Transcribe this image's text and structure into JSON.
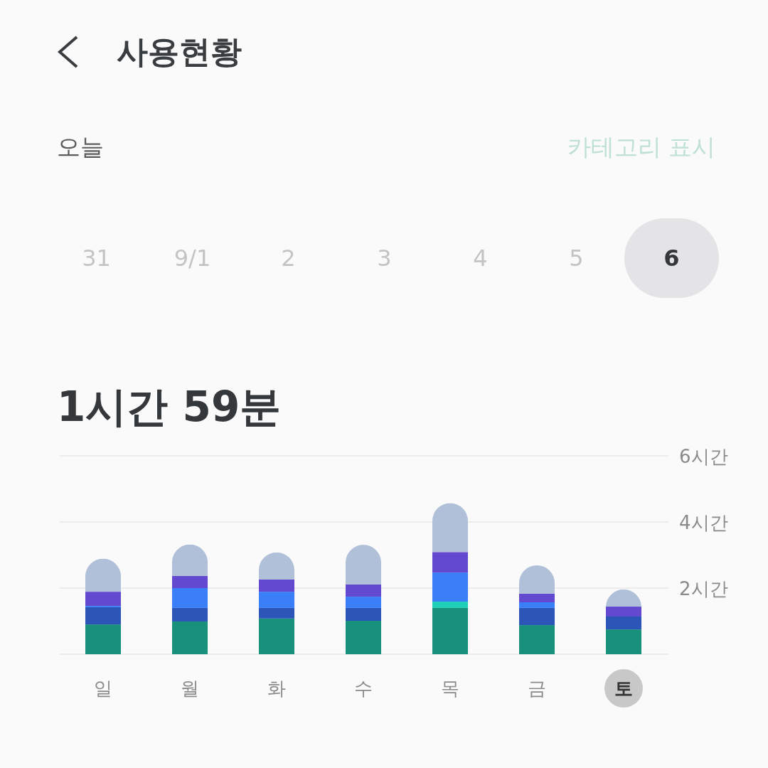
{
  "header": {
    "title": "사용현황"
  },
  "period": {
    "label": "오늘",
    "action": "카테고리 표시"
  },
  "dates": [
    {
      "label": "31",
      "selected": false
    },
    {
      "label": "9/1",
      "selected": false
    },
    {
      "label": "2",
      "selected": false
    },
    {
      "label": "3",
      "selected": false
    },
    {
      "label": "4",
      "selected": false
    },
    {
      "label": "5",
      "selected": false
    },
    {
      "label": "6",
      "selected": true
    }
  ],
  "total": "1시간 59분",
  "usage_chart": {
    "chart_data": {
      "type": "bar",
      "stacked": true,
      "ylim": [
        0,
        6
      ],
      "yticks": [
        {
          "value": 2,
          "label": "2시간"
        },
        {
          "value": 4,
          "label": "4시간"
        },
        {
          "value": 6,
          "label": "6시간"
        }
      ],
      "series": [
        {
          "color": "#17907c",
          "values": [
            0.9,
            0.99,
            1.08,
            1.01,
            1.4,
            0.88,
            0.75
          ]
        },
        {
          "color": "#2b56b8",
          "values": [
            0.52,
            0.41,
            0.32,
            0.39,
            0,
            0.52,
            0.39
          ]
        },
        {
          "color": "#1fd0b8",
          "values": [
            0,
            0,
            0,
            0,
            0.19,
            0,
            0
          ]
        },
        {
          "color": "#3a7ff8",
          "values": [
            0.04,
            0.6,
            0.49,
            0.34,
            0.88,
            0.17,
            0
          ]
        },
        {
          "color": "#6349cf",
          "values": [
            0.43,
            0.37,
            0.37,
            0.37,
            0.62,
            0.26,
            0.3
          ]
        },
        {
          "color": "#b1c0d9",
          "values": [
            1.0,
            0.95,
            0.82,
            1.2,
            1.48,
            0.86,
            0.52
          ]
        }
      ]
    },
    "days": [
      {
        "label": "일",
        "selected": false
      },
      {
        "label": "월",
        "selected": false
      },
      {
        "label": "화",
        "selected": false
      },
      {
        "label": "수",
        "selected": false
      },
      {
        "label": "목",
        "selected": false
      },
      {
        "label": "금",
        "selected": false
      },
      {
        "label": "토",
        "selected": true
      }
    ]
  }
}
